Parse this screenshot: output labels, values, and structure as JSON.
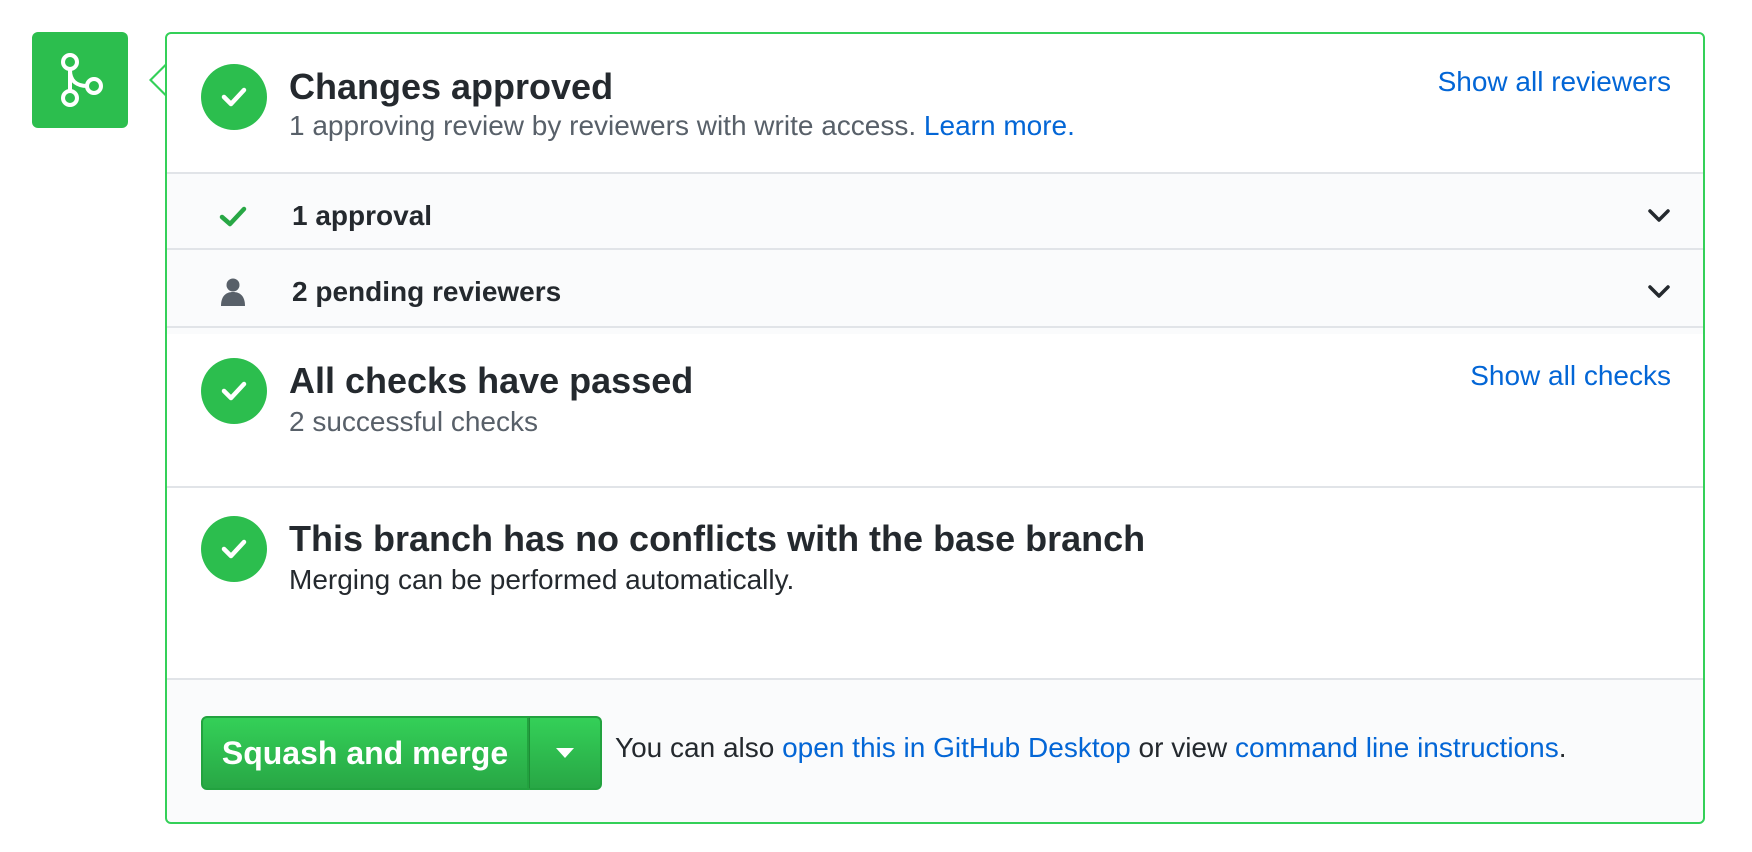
{
  "icons": {
    "merge": "git-merge-icon",
    "check": "check-icon",
    "person": "person-icon",
    "chevron": "chevron-down-icon",
    "caret": "triangle-down-icon"
  },
  "colors": {
    "success": "#2cbe4e",
    "border": "#34d058",
    "link": "#0366d6"
  },
  "review": {
    "title": "Changes approved",
    "subtitle": "1 approving review by reviewers with write access.",
    "learn_more": "Learn more.",
    "show_all": "Show all reviewers",
    "rows": [
      {
        "label": "1 approval"
      },
      {
        "label": "2 pending reviewers"
      }
    ]
  },
  "checks": {
    "title": "All checks have passed",
    "subtitle": "2 successful checks",
    "show_all": "Show all checks"
  },
  "conflicts": {
    "title": "This branch has no conflicts with the base branch",
    "subtitle": "Merging can be performed automatically."
  },
  "merge": {
    "button_label": "Squash and merge",
    "text_prefix": "You can also ",
    "desktop_link": "open this in GitHub Desktop",
    "text_middle": " or view ",
    "cli_link": "command line instructions",
    "text_suffix": "."
  }
}
